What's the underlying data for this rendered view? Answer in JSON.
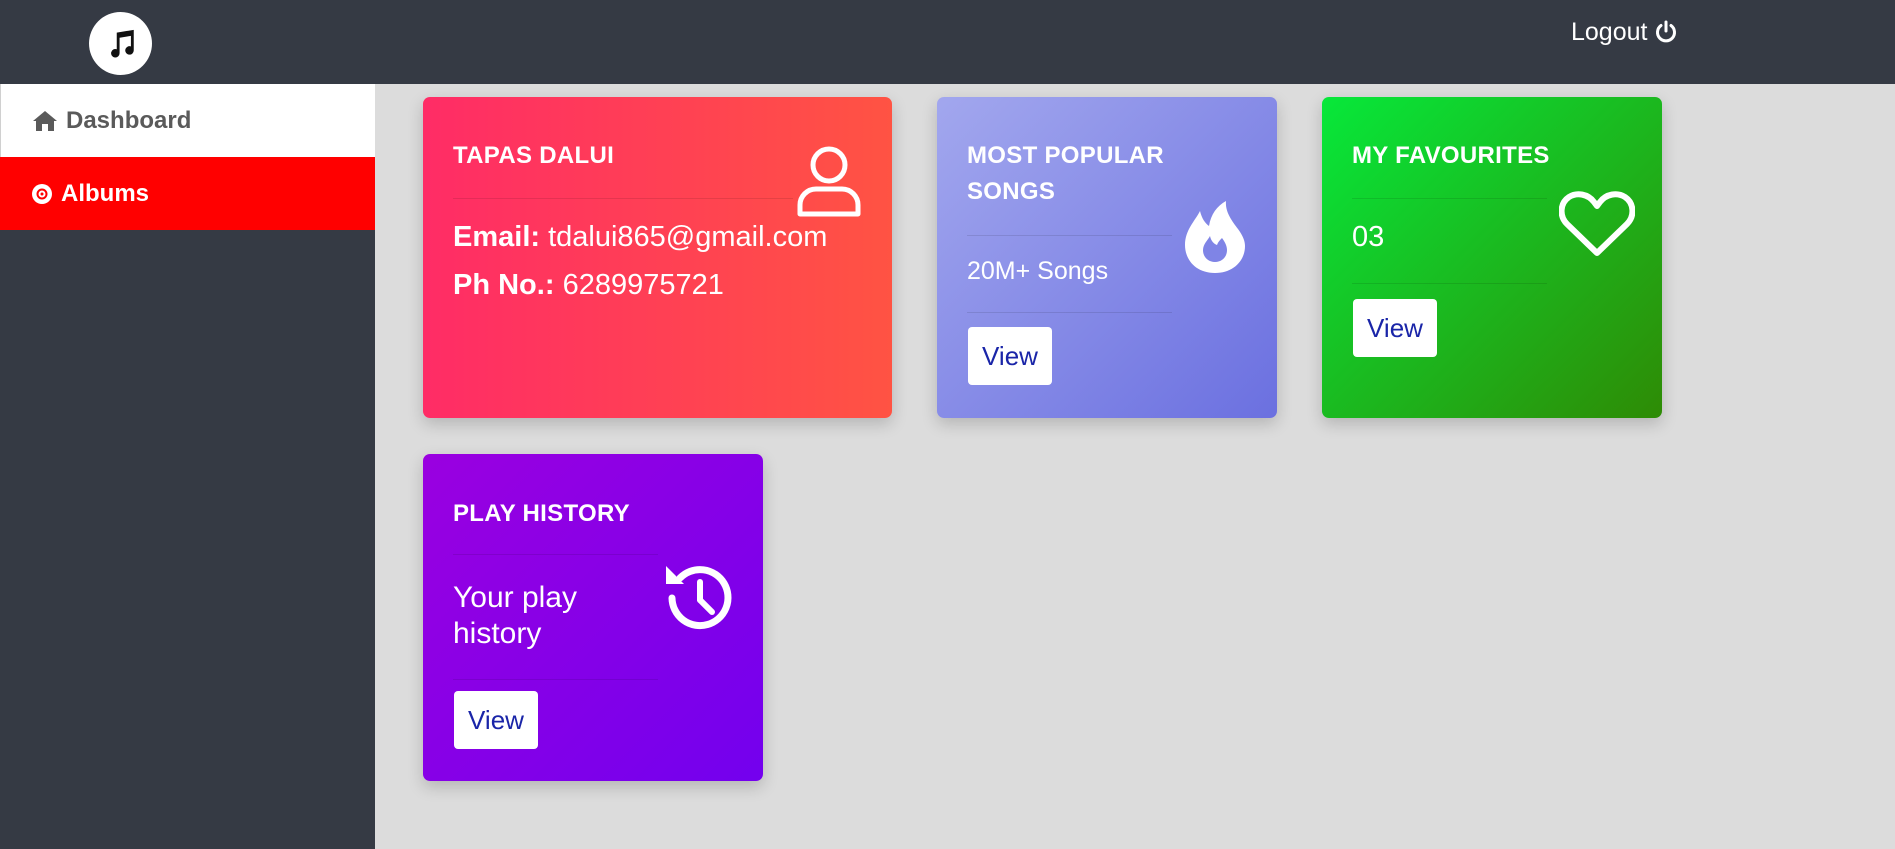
{
  "header": {
    "logout_label": "Logout"
  },
  "sidebar": {
    "items": [
      {
        "label": "Dashboard",
        "icon": "home-icon",
        "active": true
      },
      {
        "label": "Albums",
        "icon": "disc-icon",
        "active": false
      }
    ]
  },
  "cards": {
    "profile": {
      "name": "TAPAS DALUI",
      "email_label": "Email:",
      "email": "tdalui865@gmail.com",
      "phone_label": "Ph No.:",
      "phone": "6289975721",
      "icon": "user-icon"
    },
    "popular": {
      "title_line1": "MOST POPULAR",
      "title_line2": "SONGS",
      "subtitle": "20M+ Songs",
      "button": "View",
      "icon": "fire-icon"
    },
    "favourites": {
      "title": "MY FAVOURITES",
      "count": "03",
      "button": "View",
      "icon": "heart-icon"
    },
    "history": {
      "title": "PLAY HISTORY",
      "text_line1": "Your play",
      "text_line2": "history",
      "button": "View",
      "icon": "history-icon"
    }
  },
  "colors": {
    "topbar": "#353a44",
    "sidebar_active_red": "#ff0000",
    "background": "#dcdcdc",
    "button_text": "#1a25a8"
  }
}
